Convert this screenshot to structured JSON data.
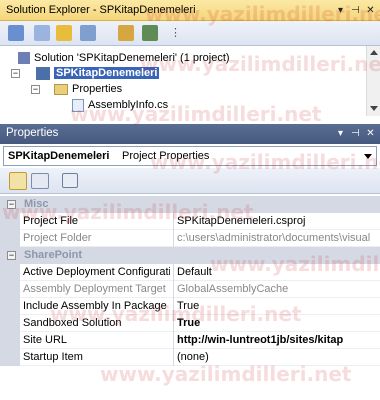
{
  "solution_explorer": {
    "title": "Solution Explorer - SPKitapDenemeleri",
    "tree": {
      "solution": "Solution 'SPKitapDenemeleri' (1 project)",
      "project": "SPKitapDenemeleri",
      "properties": "Properties",
      "file": "AssemblyInfo.cs"
    }
  },
  "properties": {
    "title": "Properties",
    "object_name": "SPKitapDenemeleri",
    "object_type": "Project Properties",
    "categories": [
      {
        "name": "Misc",
        "rows": [
          {
            "name": "Project File",
            "value": "SPKitapDenemeleri.csproj",
            "dim": false,
            "bold": false
          },
          {
            "name": "Project Folder",
            "value": "c:\\users\\administrator\\documents\\visual",
            "dim": true,
            "bold": false
          }
        ]
      },
      {
        "name": "SharePoint",
        "rows": [
          {
            "name": "Active Deployment Configuration",
            "value": "Default",
            "dim": false,
            "bold": false
          },
          {
            "name": "Assembly Deployment Target",
            "value": "GlobalAssemblyCache",
            "dim": true,
            "bold": false
          },
          {
            "name": "Include Assembly In Package",
            "value": "True",
            "dim": false,
            "bold": false
          },
          {
            "name": "Sandboxed Solution",
            "value": "True",
            "dim": false,
            "bold": true
          },
          {
            "name": "Site URL",
            "value": "http://win-luntreot1jb/sites/kitap",
            "dim": false,
            "bold": true
          },
          {
            "name": "Startup Item",
            "value": "(none)",
            "dim": false,
            "bold": false
          }
        ]
      }
    ]
  },
  "watermark": "www.yazilimdilleri.net"
}
